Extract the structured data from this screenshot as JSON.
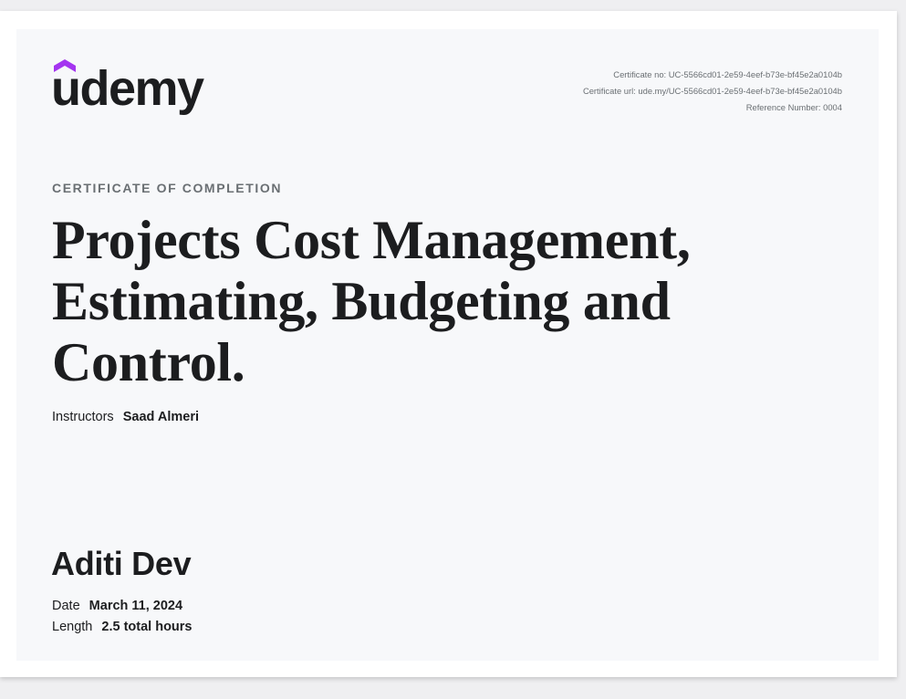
{
  "logo": {
    "text": "udemy",
    "accent_color": "#a435f0"
  },
  "certificate_meta": {
    "certificate_no": "Certificate no: UC-5566cd01-2e59-4eef-b73e-bf45e2a0104b",
    "certificate_url": "Certificate url: ude.my/UC-5566cd01-2e59-4eef-b73e-bf45e2a0104b",
    "reference_number": "Reference Number: 0004"
  },
  "eyebrow": "CERTIFICATE OF COMPLETION",
  "course_title_lines": [
    "Projects Cost Management,",
    "Estimating, Budgeting and",
    "Control."
  ],
  "instructors": {
    "label": "Instructors",
    "names": "Saad Almeri"
  },
  "recipient": "Aditi Dev",
  "details": {
    "date_label": "Date",
    "date_value": "March 11, 2024",
    "length_label": "Length",
    "length_value": "2.5 total hours"
  }
}
